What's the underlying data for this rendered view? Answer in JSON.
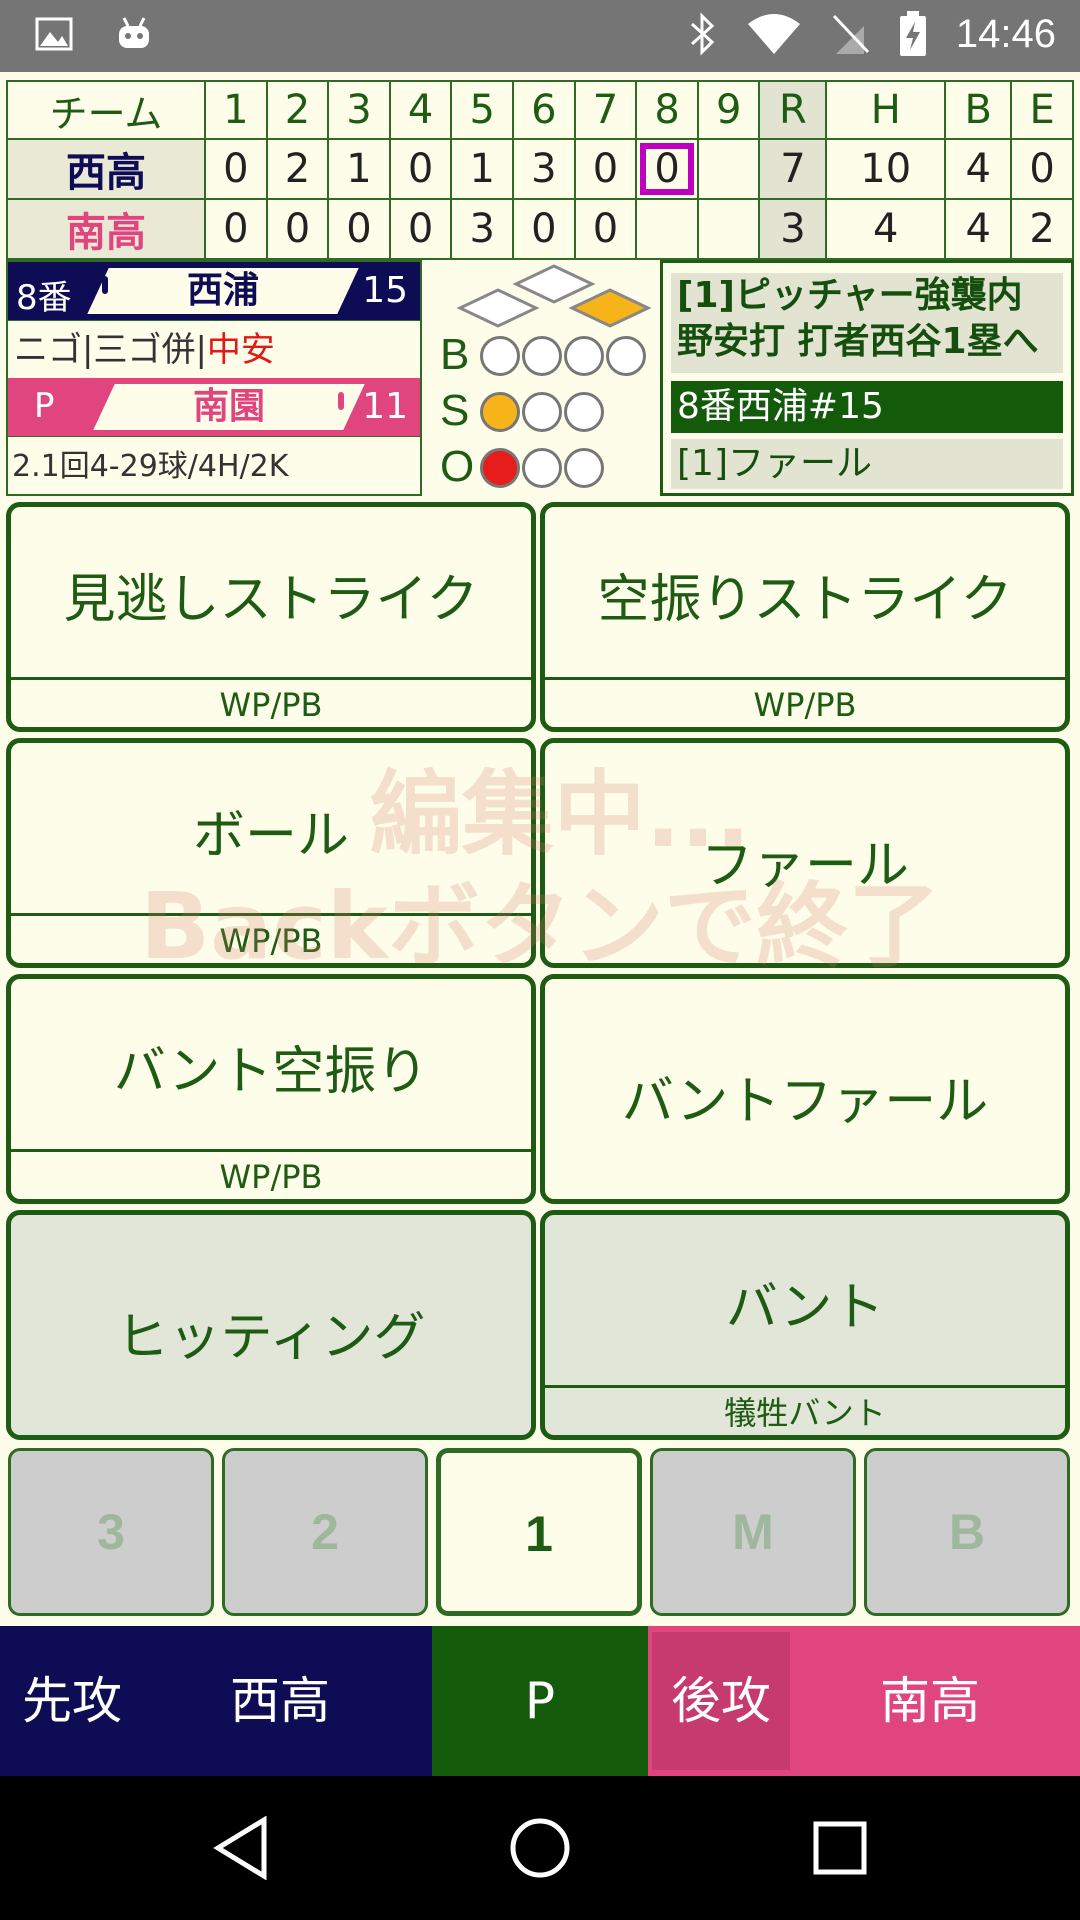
{
  "status_bar": {
    "time": "14:46",
    "left_icons": [
      "image-icon",
      "android-icon"
    ],
    "right_icons": [
      "bluetooth-icon",
      "wifi-icon",
      "no-sim-icon",
      "battery-charging-icon"
    ]
  },
  "scoreboard": {
    "team_header": "チーム",
    "innings": [
      "1",
      "2",
      "3",
      "4",
      "5",
      "6",
      "7",
      "8",
      "9"
    ],
    "totals_headers": [
      "R",
      "H",
      "B",
      "E"
    ],
    "top_team": {
      "name": "西高",
      "scores": [
        "0",
        "2",
        "1",
        "0",
        "1",
        "3",
        "0",
        "0",
        ""
      ],
      "totals": [
        "7",
        "10",
        "4",
        "0"
      ]
    },
    "bottom_team": {
      "name": "南高",
      "scores": [
        "0",
        "0",
        "0",
        "0",
        "3",
        "0",
        "0",
        "",
        ""
      ],
      "totals": [
        "3",
        "4",
        "4",
        "2"
      ]
    },
    "current_inning_index": 7
  },
  "batter": {
    "order": "8番",
    "name": "西浦",
    "number": "15"
  },
  "batter_history": {
    "prefix": "ニゴ|三ゴ併|",
    "latest": "中安"
  },
  "pitcher": {
    "label": "P",
    "name": "南園",
    "number": "11"
  },
  "pitcher_stats": "2.1回4-29球/4H/2K",
  "count": {
    "b_label": "B",
    "s_label": "S",
    "o_label": "O",
    "balls": 0,
    "strikes": 1,
    "outs": 1,
    "colors": {
      "strike": "#f6b31a",
      "out": "#e71d1d"
    }
  },
  "bases": {
    "first": true,
    "second": false,
    "third": false
  },
  "log": {
    "play_line1": "[1]ピッチャー強襲内",
    "play_line2": "野安打 打者西谷1塁へ",
    "batter": "8番西浦#15",
    "pitch": "[1]ファール"
  },
  "actions": {
    "called_strike": {
      "label": "見逃しストライク",
      "sub": "WP/PB"
    },
    "swinging_strike": {
      "label": "空振りストライク",
      "sub": "WP/PB"
    },
    "ball": {
      "label": "ボール",
      "sub": "WP/PB"
    },
    "foul": {
      "label": "ファール"
    },
    "bunt_miss": {
      "label": "バント空振り",
      "sub": "WP/PB"
    },
    "bunt_foul": {
      "label": "バントファール"
    },
    "hitting": {
      "label": "ヒッティング"
    },
    "bunt": {
      "label": "バント",
      "sub": "犠牲バント"
    }
  },
  "overlay": {
    "line1": "編集中...",
    "line2": "Backボタンで終了"
  },
  "tabs": [
    "3",
    "2",
    "1",
    "M",
    "B"
  ],
  "active_tab": "1",
  "bottom_bar": {
    "top_side": "先攻",
    "top_team": "西高",
    "mode": "P",
    "bottom_side": "後攻",
    "bottom_team": "南高",
    "colors": {
      "top": "#0e0c55",
      "mode": "#135b0b",
      "bottom": "#e0457f",
      "bottom_side_bg": "#c63a6f"
    }
  }
}
